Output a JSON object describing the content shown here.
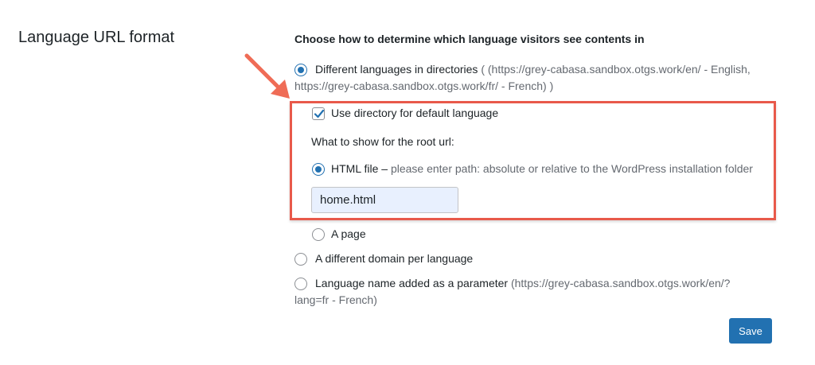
{
  "section": {
    "title": "Language URL format"
  },
  "heading": "Choose how to determine which language visitors see contents in",
  "options": {
    "directories": {
      "label": "Different languages in directories",
      "hint_line1": "( (https://grey-cabasa.sandbox.otgs.work/en/ - English,",
      "hint_line2": "https://grey-cabasa.sandbox.otgs.work/fr/ - French) )",
      "checked": true
    },
    "domain": {
      "label": "A different domain per language",
      "checked": false
    },
    "parameter": {
      "label": "Language name added as a parameter",
      "hint_line1": "(https://grey-cabasa.sandbox.otgs.work/en/?",
      "hint_line2": "lang=fr - French)",
      "checked": false
    }
  },
  "directory_settings": {
    "use_default_label": "Use directory for default language",
    "use_default_checked": true,
    "root_url_label": "What to show for the root url:",
    "html_file_label": "HTML file –",
    "html_file_hint": "please enter path: absolute or relative to the WordPress installation folder",
    "html_file_value": "home.html",
    "page_label": "A page"
  },
  "save_label": "Save",
  "colors": {
    "accent": "#2271b1",
    "highlight": "#e8594a",
    "arrow": "#ef6c56",
    "input_bg": "#e8f0fe"
  }
}
